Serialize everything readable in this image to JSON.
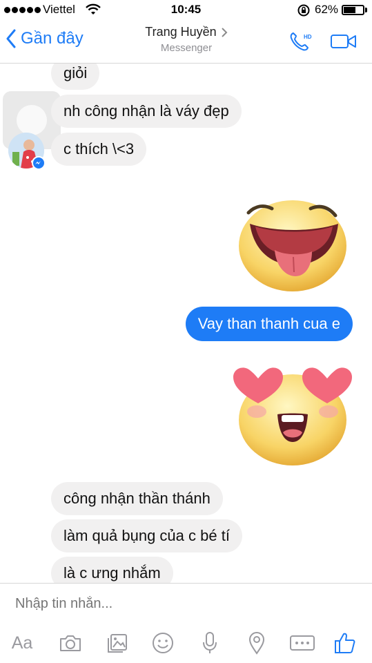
{
  "status_bar": {
    "carrier": "Viettel",
    "time": "10:45",
    "battery_percent_text": "62%",
    "battery_level": 0.62
  },
  "nav": {
    "back_label": "Gần đây",
    "contact_name": "Trang Huyền",
    "subtitle": "Messenger",
    "call_badge": "HD"
  },
  "messages": {
    "m1": "giỏi",
    "m2": "nh công nhận là váy đẹp",
    "m3": "c thích \\<3",
    "sticker1": "tongue-out-emoji-sticker",
    "out1": "Vay than thanh cua e",
    "sticker2": "heart-eyes-emoji-sticker",
    "m4": "công nhận thần thánh",
    "m5": "làm quả bụng của c bé tí",
    "m6": "là c ưng nhắm"
  },
  "composer": {
    "placeholder": "Nhập tin nhắn...",
    "aa_label": "Aa"
  },
  "colors": {
    "accent": "#1e7cf6",
    "incoming_bubble": "#f1f0f0",
    "toolbar_icon": "#9a9a9f"
  }
}
